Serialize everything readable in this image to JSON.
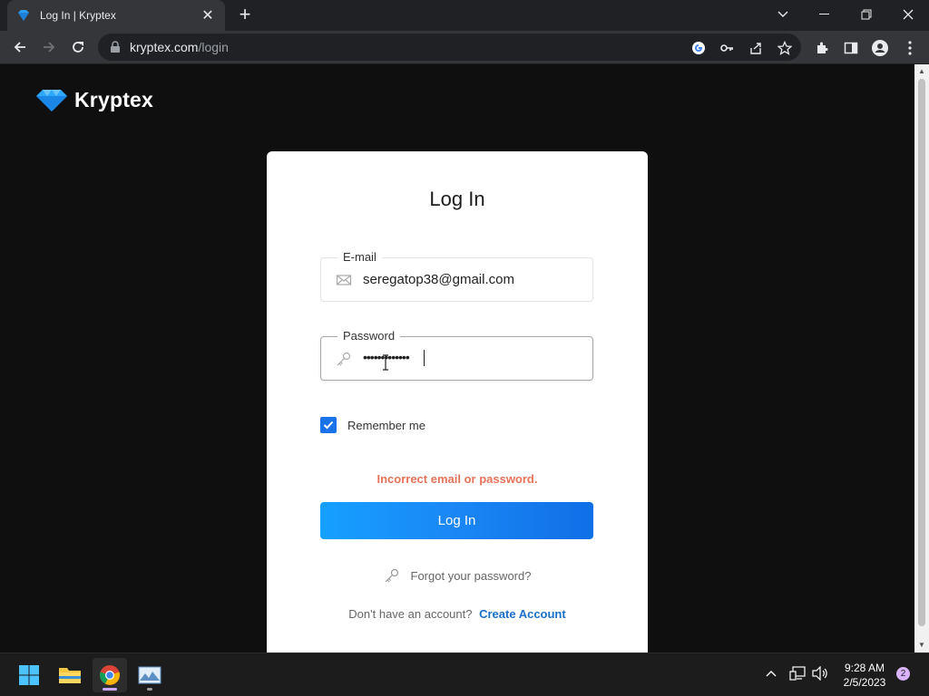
{
  "browser": {
    "tab_title": "Log In | Kryptex",
    "url_domain": "kryptex.com",
    "url_path": "/login",
    "new_tab_symbol": "+",
    "tab_close_symbol": "✕"
  },
  "site": {
    "logo_text": "Kryptex",
    "brand_color": "#1e90ff"
  },
  "login": {
    "title": "Log In",
    "email_label": "E-mail",
    "email_value": "seregatop38@gmail.com",
    "password_label": "Password",
    "password_value": "•••••••••••••",
    "remember_label": "Remember me",
    "remember_checked": true,
    "error_message": "Incorrect email or password.",
    "error_color": "#e8735a",
    "submit_label": "Log In",
    "forgot_label": "Forgot your password?",
    "signup_prompt": "Don't have an account?",
    "signup_link": "Create Account"
  },
  "taskbar": {
    "time": "9:28 AM",
    "date": "2/5/2023",
    "notification_count": "2",
    "apps": [
      "windows-start-icon",
      "file-explorer-icon",
      "chrome-icon",
      "photos-icon"
    ]
  }
}
